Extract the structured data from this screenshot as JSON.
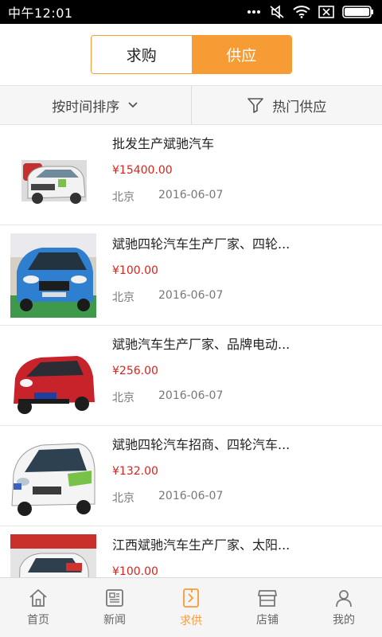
{
  "status_bar": {
    "time": "中午12:01"
  },
  "header": {
    "tab_buy": "求购",
    "tab_supply": "供应"
  },
  "filter": {
    "sort_label": "按时间排序",
    "hot_label": "热门供应"
  },
  "items": [
    {
      "title": "批发生产斌驰汽车",
      "price": "¥15400.00",
      "location": "北京",
      "date": "2016-06-07"
    },
    {
      "title": "斌驰四轮汽车生产厂家、四轮...",
      "price": "¥100.00",
      "location": "北京",
      "date": "2016-06-07"
    },
    {
      "title": "斌驰汽车生产厂家、品牌电动...",
      "price": "¥256.00",
      "location": "北京",
      "date": "2016-06-07"
    },
    {
      "title": "斌驰四轮汽车招商、四轮汽车...",
      "price": "¥132.00",
      "location": "北京",
      "date": "2016-06-07"
    },
    {
      "title": "江西斌驰汽车生产厂家、太阳...",
      "price": "¥100.00",
      "location": "",
      "date": ""
    }
  ],
  "nav": [
    {
      "label": "首页",
      "icon": "home-icon"
    },
    {
      "label": "新闻",
      "icon": "news-icon"
    },
    {
      "label": "求供",
      "icon": "supply-icon"
    },
    {
      "label": "店铺",
      "icon": "shop-icon"
    },
    {
      "label": "我的",
      "icon": "user-icon"
    }
  ],
  "colors": {
    "accent": "#f79b35",
    "price": "#d9231c"
  }
}
